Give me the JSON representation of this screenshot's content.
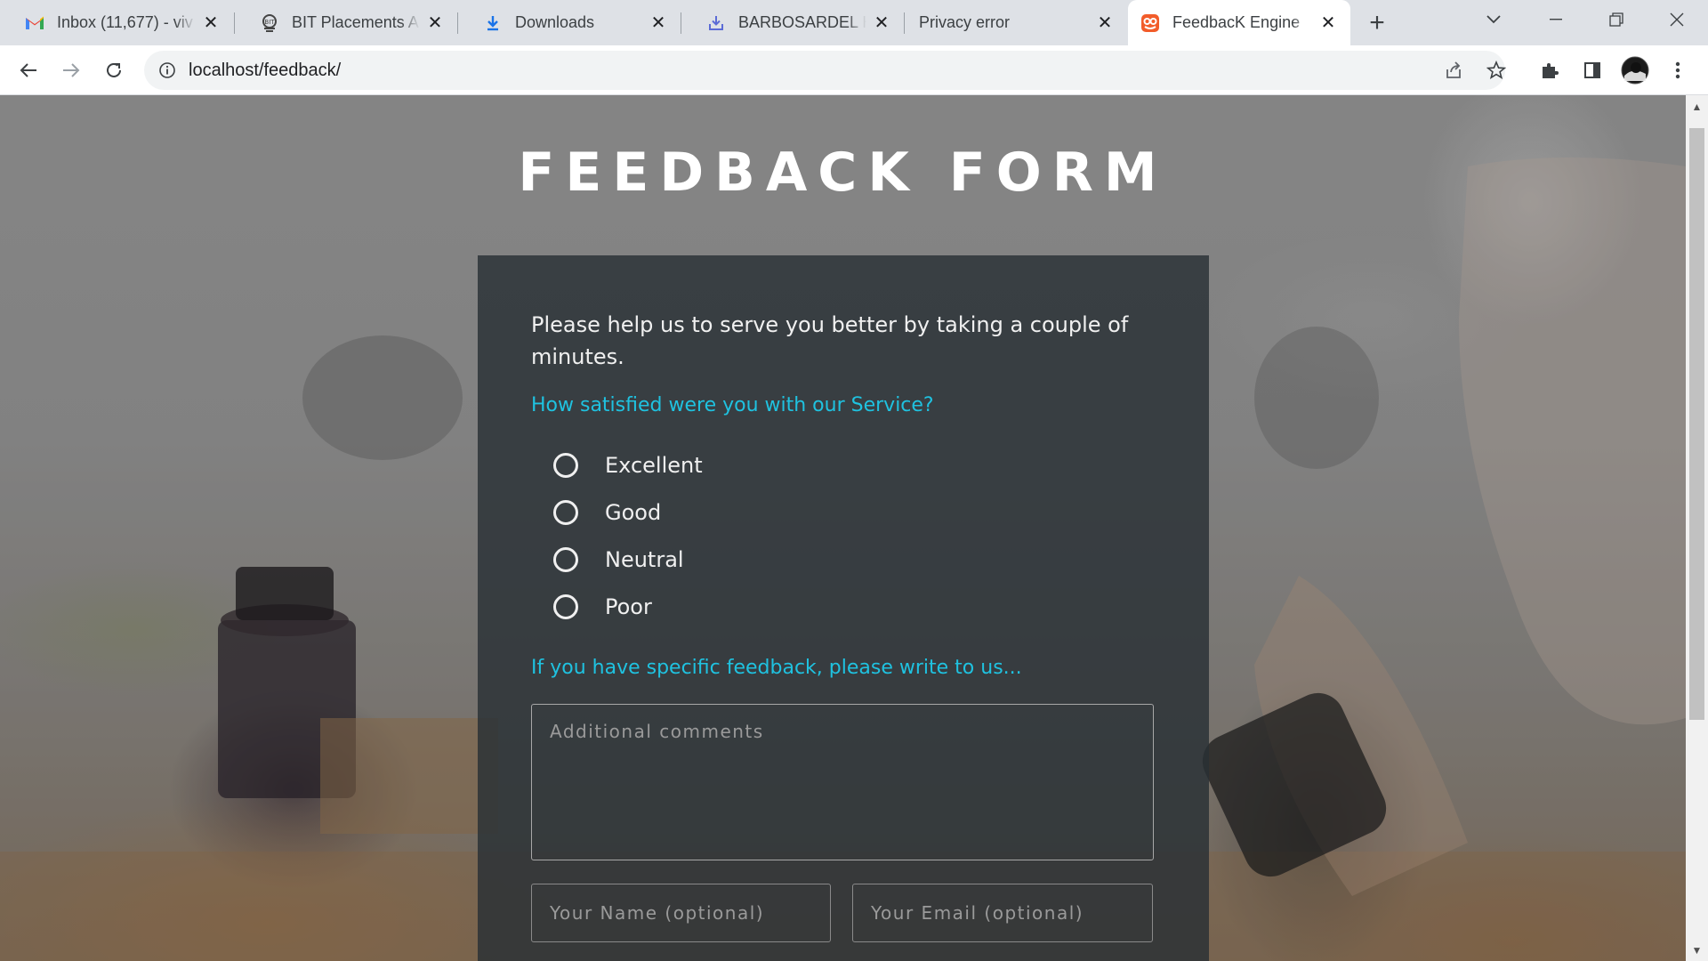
{
  "browser": {
    "tabs": [
      {
        "title": "Inbox (11,677) - viv",
        "icon": "gmail-icon"
      },
      {
        "title": "BIT Placements App",
        "icon": "bit-logo-icon"
      },
      {
        "title": "Downloads",
        "icon": "download-icon"
      },
      {
        "title": "BARBOSARDEL Нro",
        "icon": "download-box-icon"
      },
      {
        "title": "Privacy error",
        "icon": ""
      },
      {
        "title": "FeedbacK Engine",
        "icon": "feedback-engine-icon",
        "active": true
      }
    ],
    "address": "localhost/feedback/",
    "accent_color": "#1a73e8"
  },
  "page": {
    "heading": "FEEDBACK FORM",
    "intro": "Please help us to serve you better by taking a couple of minutes.",
    "question": "How satisfied were you with our Service?",
    "options": [
      "Excellent",
      "Good",
      "Neutral",
      "Poor"
    ],
    "feedback_prompt": "If you have specific feedback, please write to us...",
    "comments_placeholder": "Additional comments",
    "name_placeholder": "Your Name (optional)",
    "email_placeholder": "Your Email (optional)",
    "accent_color": "#1fc2e0"
  }
}
